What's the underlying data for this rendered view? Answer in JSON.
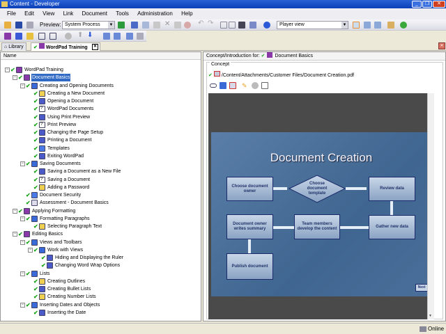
{
  "window": {
    "title": "Content - Developer"
  },
  "menu": [
    "File",
    "Edit",
    "View",
    "Link",
    "Document",
    "Tools",
    "Administration",
    "Help"
  ],
  "toolbar": {
    "preview_label": "Preview:",
    "preview_value": "System Process",
    "view_value": "Player view"
  },
  "tabs": {
    "library": "Library",
    "active": "WordPad Training"
  },
  "tree": {
    "header": "Name",
    "items": [
      {
        "label": "WordPad Training",
        "level": 0,
        "icon": "book-icon",
        "exp": true
      },
      {
        "label": "Document Basics",
        "level": 1,
        "icon": "book-icon",
        "exp": true,
        "selected": true
      },
      {
        "label": "Creating and Opening Documents",
        "level": 2,
        "icon": "section-icon",
        "exp": true
      },
      {
        "label": "Creating a New Document",
        "level": 3,
        "icon": "topic-icon"
      },
      {
        "label": "Opening a Document",
        "level": 3,
        "icon": "simulation-icon"
      },
      {
        "label": "WordPad Documents",
        "level": 3,
        "icon": "question-icon"
      },
      {
        "label": "Using Print Preview",
        "level": 3,
        "icon": "simulation-icon"
      },
      {
        "label": "Print Preview",
        "level": 3,
        "icon": "question-icon"
      },
      {
        "label": "Changing the Page Setup",
        "level": 3,
        "icon": "simulation-icon"
      },
      {
        "label": "Printing a Document",
        "level": 3,
        "icon": "simulation-icon"
      },
      {
        "label": "Templates",
        "level": 3,
        "icon": "document-icon"
      },
      {
        "label": "Exiting WordPad",
        "level": 3,
        "icon": "simulation-icon"
      },
      {
        "label": "Saving Documents",
        "level": 2,
        "icon": "section-icon",
        "exp": true
      },
      {
        "label": "Saving a Document as a New File",
        "level": 3,
        "icon": "simulation-icon"
      },
      {
        "label": "Saving a Document",
        "level": 3,
        "icon": "question-icon"
      },
      {
        "label": "Adding a Password",
        "level": 3,
        "icon": "topic-icon"
      },
      {
        "label": "Document Security",
        "level": 2,
        "icon": "document-icon"
      },
      {
        "label": "Assessment - Document Basics",
        "level": 2,
        "icon": "assessment-icon"
      },
      {
        "label": "Applying Formatting",
        "level": 1,
        "icon": "book-icon",
        "exp": true
      },
      {
        "label": "Formatting Paragraphs",
        "level": 2,
        "icon": "section-icon",
        "exp": true
      },
      {
        "label": "Selecting Paragraph Text",
        "level": 3,
        "icon": "topic-icon"
      },
      {
        "label": "Editing Basics",
        "level": 1,
        "icon": "book-icon",
        "exp": true
      },
      {
        "label": "Views and Toolbars",
        "level": 2,
        "icon": "section-icon",
        "exp": true
      },
      {
        "label": "Work with Views",
        "level": 3,
        "icon": "section-icon",
        "exp": true
      },
      {
        "label": "Hiding and Displaying the Ruler",
        "level": 4,
        "icon": "simulation-icon"
      },
      {
        "label": "Changing Word Wrap Options",
        "level": 4,
        "icon": "simulation-icon"
      },
      {
        "label": "Lists",
        "level": 2,
        "icon": "section-icon",
        "exp": true
      },
      {
        "label": "Creating Outlines",
        "level": 3,
        "icon": "topic-icon"
      },
      {
        "label": "Creating Bullet Lists",
        "level": 3,
        "icon": "simulation-icon"
      },
      {
        "label": "Creating Number Lists",
        "level": 3,
        "icon": "topic-icon"
      },
      {
        "label": "Inserting Dates and Objects",
        "level": 2,
        "icon": "section-icon",
        "exp": true
      },
      {
        "label": "Inserting the Date",
        "level": 3,
        "icon": "simulation-icon"
      }
    ]
  },
  "right": {
    "header_label": "Concept/Introduction for:",
    "header_item": "Document Basics",
    "group": "Concept",
    "path": "/Content/Attachments/Customer Files/Document Creation.pdf"
  },
  "slide": {
    "title": "Document Creation",
    "boxes": [
      "Choose document owner",
      "Choose document template",
      "Review data",
      "Gather new data",
      "Team members develop the content",
      "Document owner writes summary",
      "Publish document"
    ],
    "next": "Next"
  },
  "status": {
    "text": "Online"
  },
  "colors": {
    "check": "#1aa51a",
    "selection": "#316ac5",
    "book": "#8a3aa8",
    "section": "#3a6ad8"
  }
}
